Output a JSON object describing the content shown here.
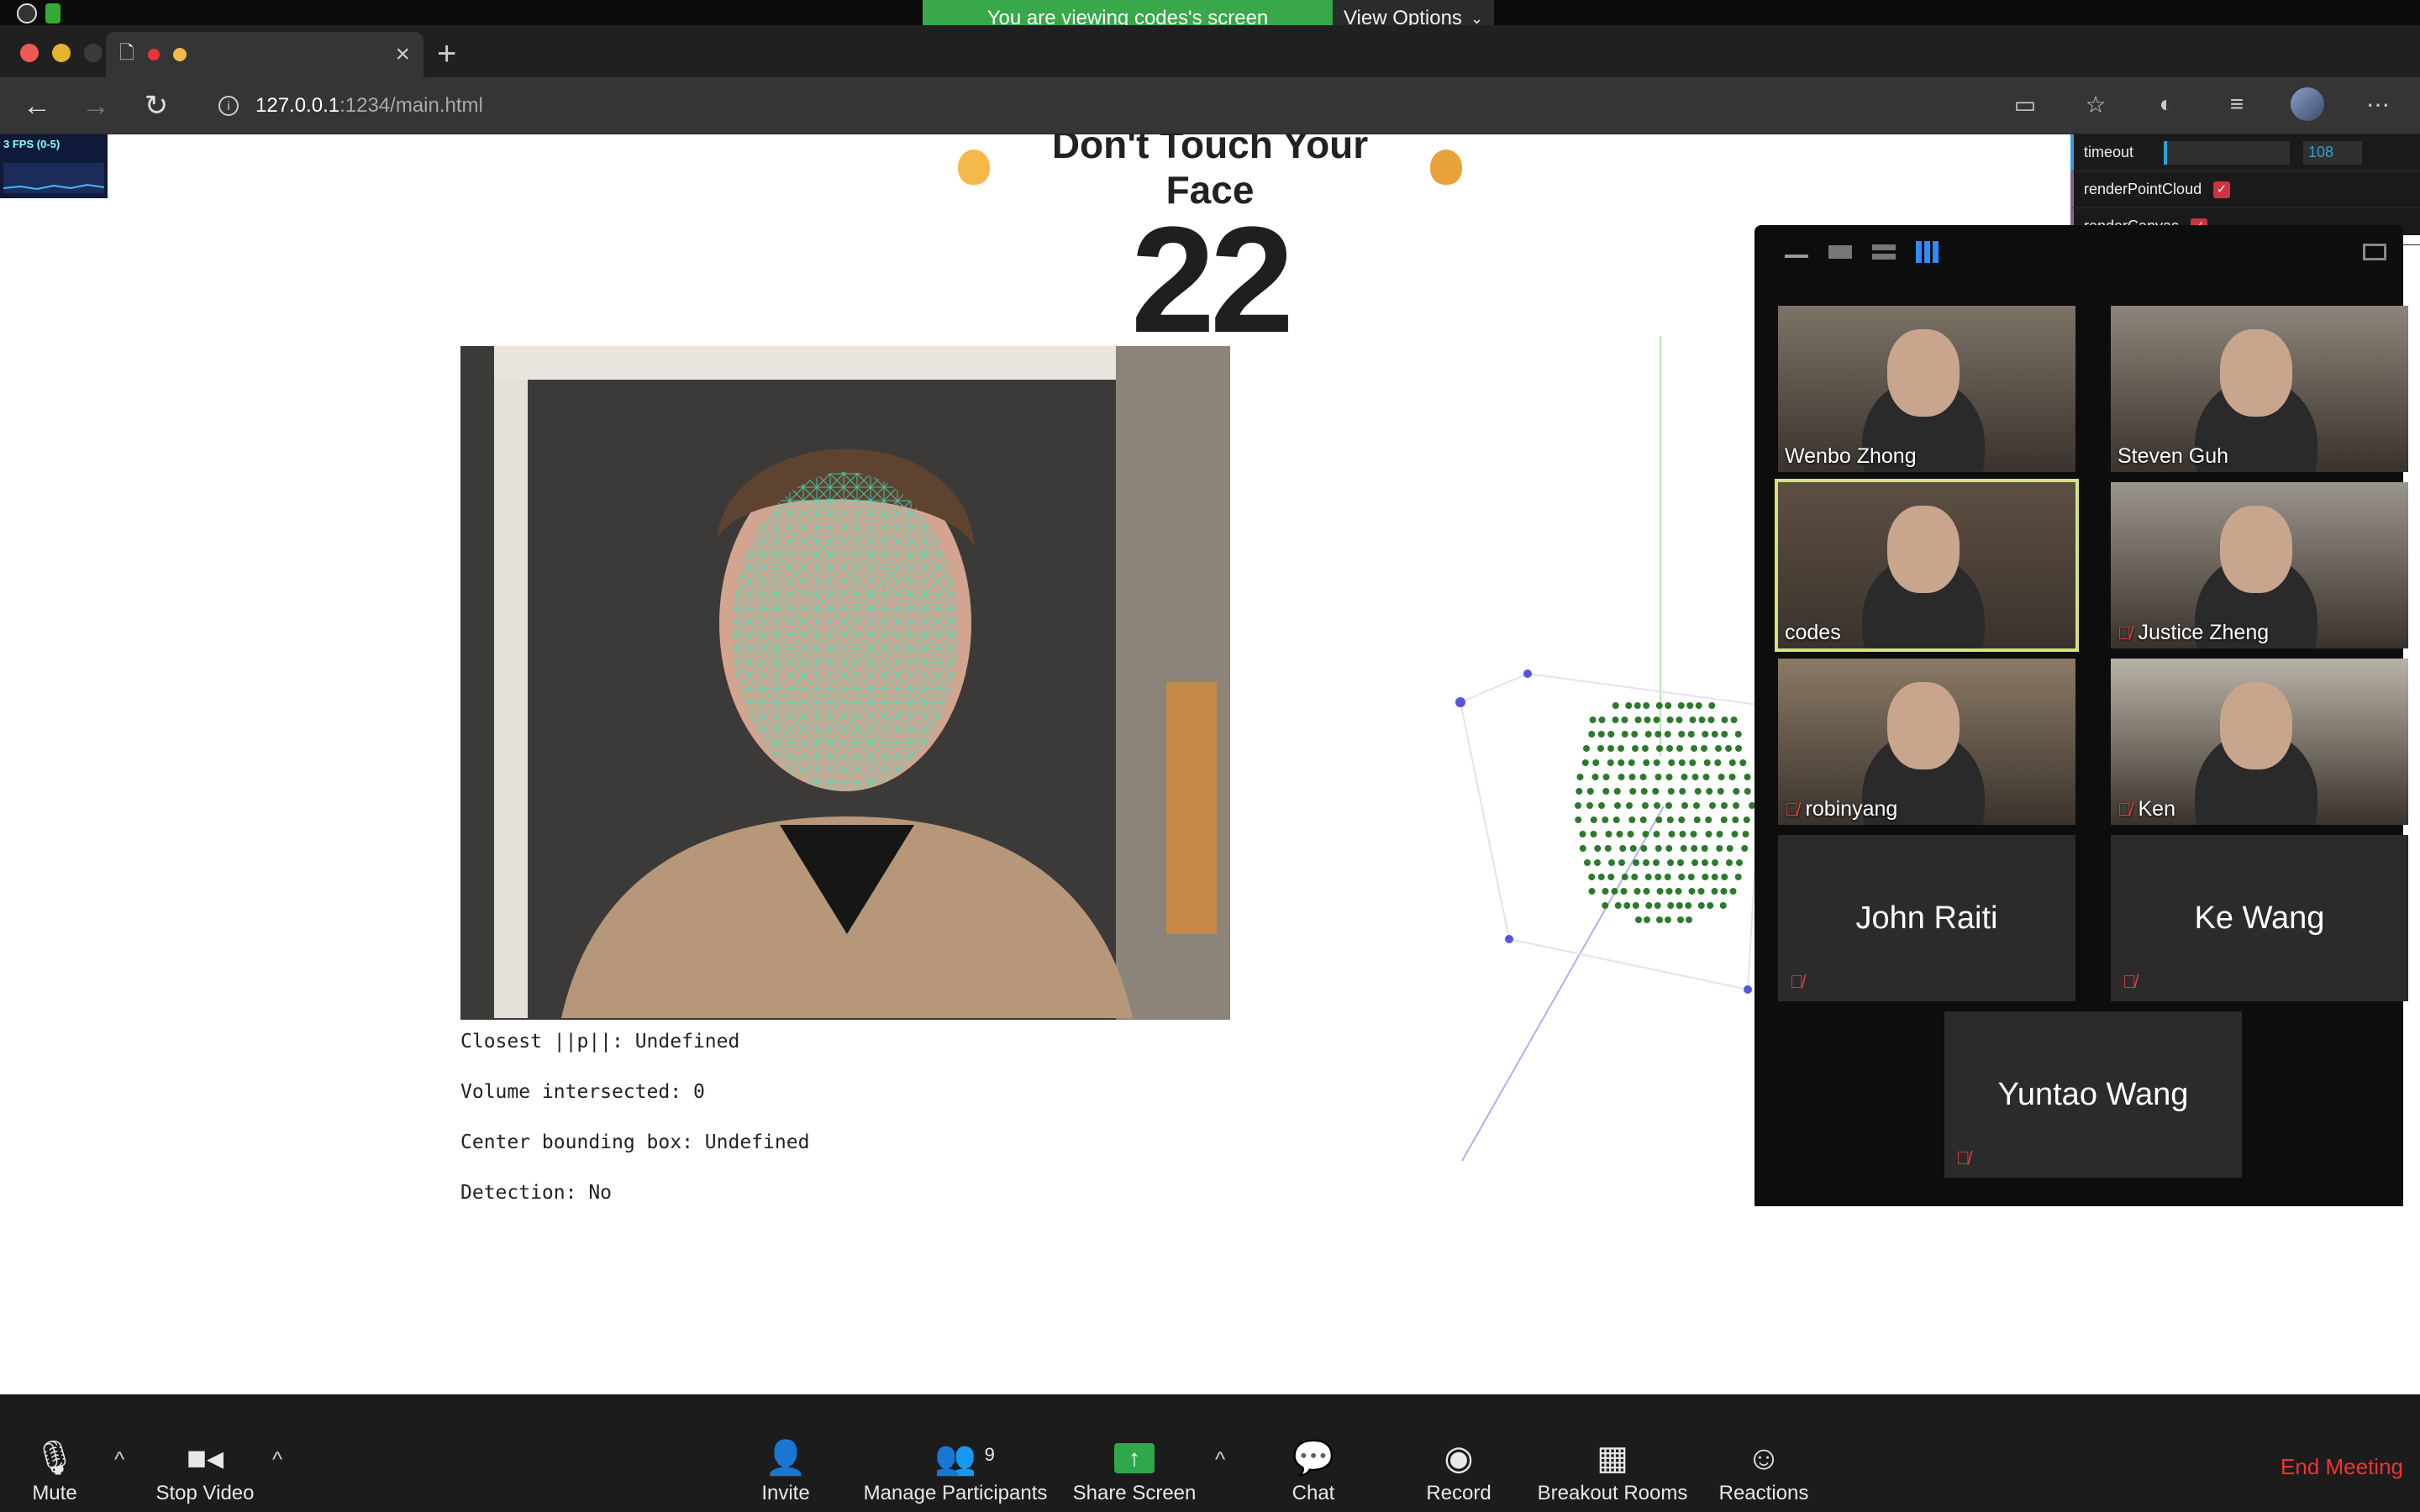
{
  "share_banner": {
    "text": "You are viewing codes's screen",
    "view_options": "View Options"
  },
  "browser": {
    "url_host": "127.0.0.1",
    "url_path": ":1234/main.html"
  },
  "page": {
    "fps_label": "3 FPS (0-5)",
    "title": "Don't Touch Your Face",
    "counter": "22",
    "stats": {
      "closest": "Closest ||p||: Undefined",
      "volume": "Volume intersected: 0",
      "center": "Center bounding box: Undefined",
      "detection": "Detection: No"
    },
    "gui": {
      "timeout_label": "timeout",
      "timeout_value": "108",
      "render_point_cloud": "renderPointCloud",
      "render_canvas": "renderCanvas"
    }
  },
  "gallery": {
    "participants": [
      {
        "name": "Wenbo Zhong",
        "video": true,
        "muted": false
      },
      {
        "name": "Steven Guh",
        "video": true,
        "muted": false
      },
      {
        "name": "codes",
        "video": true,
        "muted": false,
        "active": true
      },
      {
        "name": "Justice Zheng",
        "video": true,
        "muted": true
      },
      {
        "name": "robinyang",
        "video": true,
        "muted": true
      },
      {
        "name": "Ken",
        "video": true,
        "muted": true
      },
      {
        "name": "John Raiti",
        "video": false,
        "muted": true
      },
      {
        "name": "Ke Wang",
        "video": false,
        "muted": true
      },
      {
        "name": "Yuntao Wang",
        "video": false,
        "muted": true
      }
    ]
  },
  "toolbar": {
    "mute": "Mute",
    "stop_video": "Stop Video",
    "invite": "Invite",
    "manage_participants": "Manage Participants",
    "participant_count": "9",
    "share_screen": "Share Screen",
    "chat": "Chat",
    "record": "Record",
    "breakout_rooms": "Breakout Rooms",
    "reactions": "Reactions",
    "end_meeting": "End Meeting"
  },
  "colors": {
    "banner_green": "#38a84b",
    "active_speaker": "#d4e37a",
    "end_meeting_red": "#e33333",
    "mesh": "#3fe0c0",
    "cloud_green": "#2d7a2d"
  }
}
